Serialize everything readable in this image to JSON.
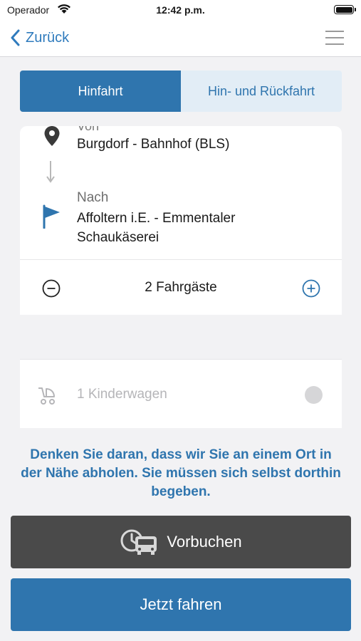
{
  "status_bar": {
    "carrier": "Operador",
    "time": "12:42 p.m."
  },
  "nav": {
    "back_label": "Zurück",
    "icons": [
      "chevron-left-icon",
      "hamburger-menu-icon"
    ]
  },
  "trip_type": {
    "options": [
      "Hinfahrt",
      "Hin- und Rückfahrt"
    ],
    "selected": "Hinfahrt"
  },
  "route": {
    "from_label": "Von",
    "from_value": "Burgdorf - Bahnhof (BLS)",
    "to_label": "Nach",
    "to_value": "Affoltern i.E. - Emmentaler Schaukäserei"
  },
  "passengers": {
    "label": "2 Fahrgäste"
  },
  "stroller": {
    "label": "1 Kinderwagen",
    "enabled": false
  },
  "notice": "Denken Sie daran, dass wir Sie an einem Ort in der Nähe abholen. Sie müssen sich selbst dorthin begeben.",
  "actions": {
    "prebook_label": "Vorbuchen",
    "now_label": "Jetzt fahren"
  },
  "colors": {
    "accent": "#2f75ae",
    "accent_light": "#e2edf6",
    "dark_button": "#4a4a4a",
    "background": "#f2f2f4"
  }
}
